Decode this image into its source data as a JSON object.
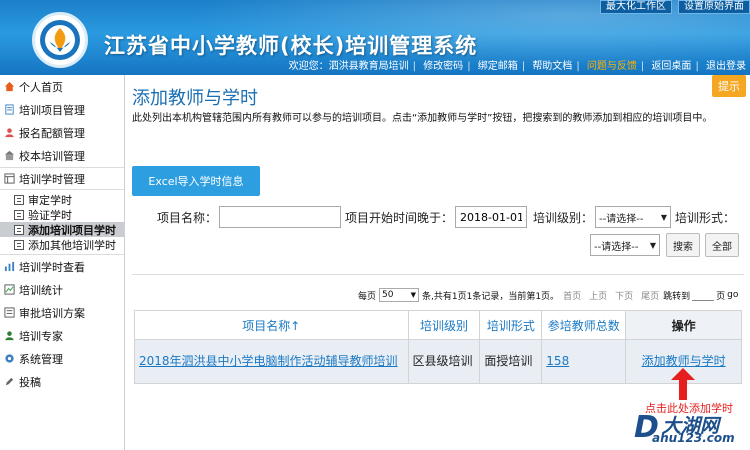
{
  "header": {
    "title": "江苏省中小学教师(校长)培训管理系统",
    "top_links": [
      "最大化工作区",
      "设置原始界面"
    ],
    "usernav": {
      "welcome": "欢迎您：泗洪县教育局培训",
      "items": [
        "修改密码",
        "绑定邮箱",
        "帮助文档",
        "问题与反馈",
        "返回桌面",
        "退出登录"
      ],
      "highlight_index": 3
    }
  },
  "sidebar": {
    "items": [
      {
        "label": "个人首页",
        "icon": "home-icon"
      },
      {
        "label": "培训项目管理",
        "icon": "doc-icon"
      },
      {
        "label": "报名配额管理",
        "icon": "user-icon"
      },
      {
        "label": "校本培训管理",
        "icon": "school-icon"
      },
      {
        "label": "培训学时管理",
        "icon": "table-icon"
      }
    ],
    "subitems": [
      "审定学时",
      "验证学时",
      "添加培训项目学时",
      "添加其他培训学时"
    ],
    "active_subitem": 2,
    "items_after": [
      {
        "label": "培训学时查看",
        "icon": "chart-icon"
      },
      {
        "label": "培训统计",
        "icon": "stats-icon"
      },
      {
        "label": "审批培训方案",
        "icon": "approve-icon"
      },
      {
        "label": "培训专家",
        "icon": "expert-icon"
      },
      {
        "label": "系统管理",
        "icon": "gear-icon"
      },
      {
        "label": "投稿",
        "icon": "pen-icon"
      }
    ]
  },
  "main": {
    "title": "添加教师与学时",
    "tip_label": "提示",
    "description": "此处列出本机构管辖范围内所有教师可以参与的培训项目。点击“添加教师与学时”按钮，把搜索到的教师添加到相应的培训项目中。",
    "excel_button": "Excel导入学时信息",
    "filters": {
      "project_name_label": "项目名称：",
      "project_name_value": "",
      "start_after_label": "项目开始时间晚于：",
      "start_after_value": "2018-01-01",
      "level_label": "培训级别：",
      "level_value": "--请选择--",
      "form_label": "培训形式：",
      "form_value": "--请选择--",
      "search_button": "搜索",
      "all_button": "全部"
    },
    "pager": {
      "per_page_prefix": "每页",
      "per_page_value": "50",
      "summary": "条,共有1页1条记录，当前第1页。",
      "first": "首页",
      "prev": "上页",
      "next": "下页",
      "last": "尾页",
      "goto_prefix": "跳转到",
      "goto_suffix": "页",
      "go": "go"
    },
    "table": {
      "headers": [
        "项目名称↑",
        "培训级别",
        "培训形式",
        "参培教师总数",
        "操作"
      ],
      "rows": [
        {
          "name": "2018年泗洪县中小学电脑制作活动辅导教师培训",
          "level": "区县级培训",
          "form": "面授培训",
          "count": "158",
          "action": "添加教师与学时"
        }
      ]
    },
    "annotation": "点击此处添加学时",
    "watermark": {
      "letter": "D",
      "brand": "大湖网",
      "domain": "ahu123.com"
    }
  },
  "colors": {
    "header_blue": "#1b7fc9",
    "link_blue": "#1b79c4",
    "accent_orange": "#f5a623",
    "button_blue": "#2d9fe0",
    "arrow_red": "#e61e1e"
  }
}
